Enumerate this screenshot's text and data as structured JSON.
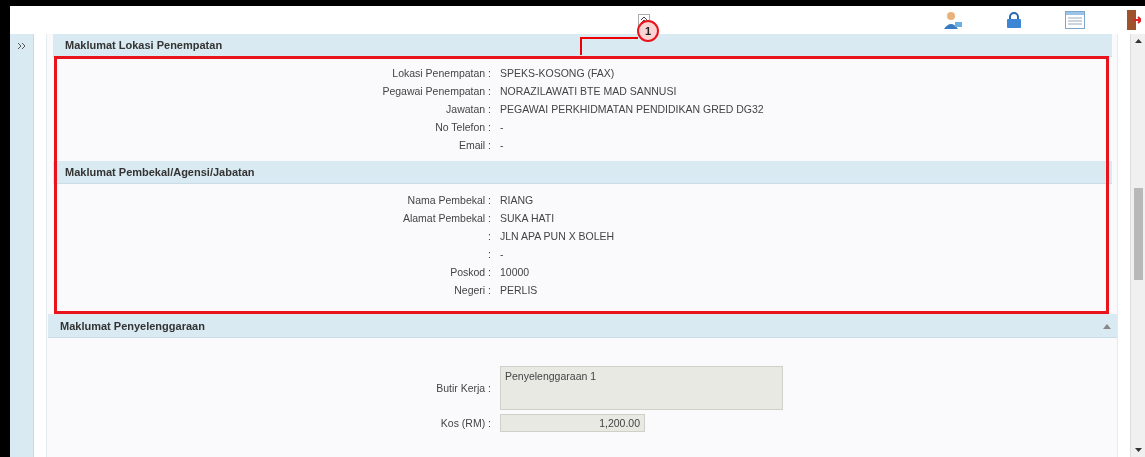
{
  "callout": {
    "number": "1"
  },
  "sections": [
    {
      "title": "Maklumat Lokasi Penempatan",
      "highlighted": true,
      "collapsible": false,
      "fields": [
        {
          "label": "Lokasi Penempatan :",
          "value": "SPEKS-KOSONG (FAX)",
          "kind": "text"
        },
        {
          "label": "Pegawai Penempatan :",
          "value": "NORAZILAWATI BTE MAD SANNUSI",
          "kind": "text"
        },
        {
          "label": "Jawatan :",
          "value": "PEGAWAI PERKHIDMATAN PENDIDIKAN GRED DG32",
          "kind": "text"
        },
        {
          "label": "No Telefon :",
          "value": "-",
          "kind": "text"
        },
        {
          "label": "Email :",
          "value": "-",
          "kind": "text"
        }
      ]
    },
    {
      "title": "Maklumat Pembekal/Agensi/Jabatan",
      "highlighted": true,
      "collapsible": false,
      "fields": [
        {
          "label": "Nama Pembekal :",
          "value": "RIANG",
          "kind": "text"
        },
        {
          "label": "Alamat Pembekal :",
          "value": "SUKA HATI",
          "kind": "text"
        },
        {
          "label": ":",
          "value": "JLN APA PUN X BOLEH",
          "kind": "text"
        },
        {
          "label": ":",
          "value": "-",
          "kind": "text"
        },
        {
          "label": "Poskod :",
          "value": "10000",
          "kind": "text"
        },
        {
          "label": "Negeri :",
          "value": "PERLIS",
          "kind": "text"
        }
      ]
    },
    {
      "title": "Maklumat Penyelenggaraan",
      "highlighted": false,
      "collapsible": true,
      "fields": [
        {
          "label": "Butir Kerja :",
          "value": "Penyelenggaraan 1",
          "kind": "textarea"
        },
        {
          "label": "Kos (RM) :",
          "value": "1,200.00",
          "kind": "number"
        }
      ]
    }
  ]
}
